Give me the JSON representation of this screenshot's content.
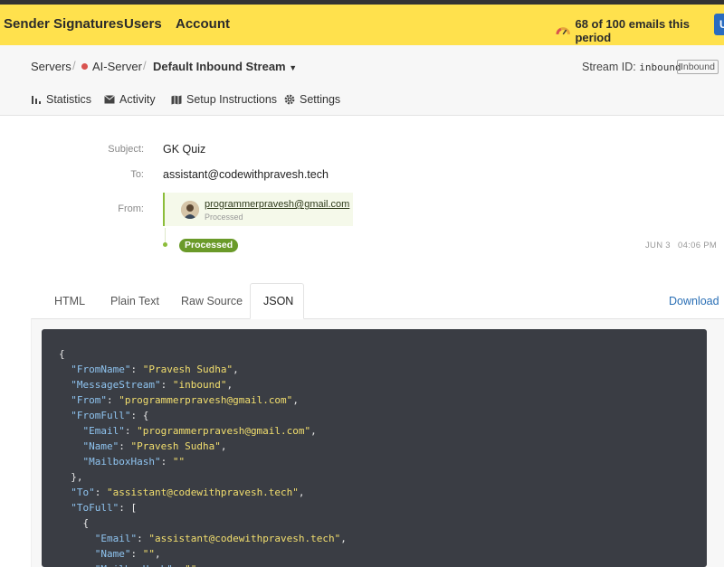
{
  "topbar": {
    "nav": [
      "Sender Signatures",
      "Users",
      "Account"
    ],
    "usage_text": "68 of 100 emails this period",
    "button_glyph": "U",
    "colors": {
      "bar": "#ffe14d",
      "button": "#2a6cc0"
    }
  },
  "breadcrumb": {
    "servers": "Servers",
    "server": "AI-Server",
    "stream": "Default Inbound Stream",
    "stream_id_label": "Stream ID:",
    "stream_id_value": "inbound",
    "stream_tag": "Inbound"
  },
  "subnav": {
    "statistics": "Statistics",
    "activity": "Activity",
    "setup": "Setup Instructions",
    "settings": "Settings"
  },
  "message": {
    "subject_label": "Subject:",
    "subject": "GK Quiz",
    "to_label": "To:",
    "to": "assistant@codewithpravesh.tech",
    "from_label": "From:",
    "from_email": "programmerpravesh@gmail.com",
    "from_status": "Processed",
    "event_badge": "Processed",
    "event_date": "JUN 3",
    "event_time": "04:06 PM",
    "colors": {
      "processed": "#6a9a29"
    }
  },
  "tabs": {
    "html": "HTML",
    "plain": "Plain Text",
    "raw": "Raw Source",
    "json": "JSON",
    "active": "JSON",
    "download": "Download"
  },
  "json_view": {
    "lines": [
      [
        {
          "t": "{",
          "c": "p"
        }
      ],
      [
        {
          "t": "  ",
          "c": "p"
        },
        {
          "t": "\"FromName\"",
          "c": "k"
        },
        {
          "t": ": ",
          "c": "p"
        },
        {
          "t": "\"Pravesh Sudha\"",
          "c": "s"
        },
        {
          "t": ",",
          "c": "p"
        }
      ],
      [
        {
          "t": "  ",
          "c": "p"
        },
        {
          "t": "\"MessageStream\"",
          "c": "k"
        },
        {
          "t": ": ",
          "c": "p"
        },
        {
          "t": "\"inbound\"",
          "c": "s"
        },
        {
          "t": ",",
          "c": "p"
        }
      ],
      [
        {
          "t": "  ",
          "c": "p"
        },
        {
          "t": "\"From\"",
          "c": "k"
        },
        {
          "t": ": ",
          "c": "p"
        },
        {
          "t": "\"programmerpravesh@gmail.com\"",
          "c": "s"
        },
        {
          "t": ",",
          "c": "p"
        }
      ],
      [
        {
          "t": "  ",
          "c": "p"
        },
        {
          "t": "\"FromFull\"",
          "c": "k"
        },
        {
          "t": ": {",
          "c": "p"
        }
      ],
      [
        {
          "t": "    ",
          "c": "p"
        },
        {
          "t": "\"Email\"",
          "c": "k"
        },
        {
          "t": ": ",
          "c": "p"
        },
        {
          "t": "\"programmerpravesh@gmail.com\"",
          "c": "s"
        },
        {
          "t": ",",
          "c": "p"
        }
      ],
      [
        {
          "t": "    ",
          "c": "p"
        },
        {
          "t": "\"Name\"",
          "c": "k"
        },
        {
          "t": ": ",
          "c": "p"
        },
        {
          "t": "\"Pravesh Sudha\"",
          "c": "s"
        },
        {
          "t": ",",
          "c": "p"
        }
      ],
      [
        {
          "t": "    ",
          "c": "p"
        },
        {
          "t": "\"MailboxHash\"",
          "c": "k"
        },
        {
          "t": ": ",
          "c": "p"
        },
        {
          "t": "\"\"",
          "c": "s"
        }
      ],
      [
        {
          "t": "  },",
          "c": "p"
        }
      ],
      [
        {
          "t": "  ",
          "c": "p"
        },
        {
          "t": "\"To\"",
          "c": "k"
        },
        {
          "t": ": ",
          "c": "p"
        },
        {
          "t": "\"assistant@codewithpravesh.tech\"",
          "c": "s"
        },
        {
          "t": ",",
          "c": "p"
        }
      ],
      [
        {
          "t": "  ",
          "c": "p"
        },
        {
          "t": "\"ToFull\"",
          "c": "k"
        },
        {
          "t": ": [",
          "c": "p"
        }
      ],
      [
        {
          "t": "    {",
          "c": "p"
        }
      ],
      [
        {
          "t": "      ",
          "c": "p"
        },
        {
          "t": "\"Email\"",
          "c": "k"
        },
        {
          "t": ": ",
          "c": "p"
        },
        {
          "t": "\"assistant@codewithpravesh.tech\"",
          "c": "s"
        },
        {
          "t": ",",
          "c": "p"
        }
      ],
      [
        {
          "t": "      ",
          "c": "p"
        },
        {
          "t": "\"Name\"",
          "c": "k"
        },
        {
          "t": ": ",
          "c": "p"
        },
        {
          "t": "\"\"",
          "c": "s"
        },
        {
          "t": ",",
          "c": "p"
        }
      ],
      [
        {
          "t": "      ",
          "c": "p"
        },
        {
          "t": "\"MailboxHash\"",
          "c": "k"
        },
        {
          "t": ": ",
          "c": "p"
        },
        {
          "t": "\"\"",
          "c": "s"
        }
      ]
    ]
  }
}
